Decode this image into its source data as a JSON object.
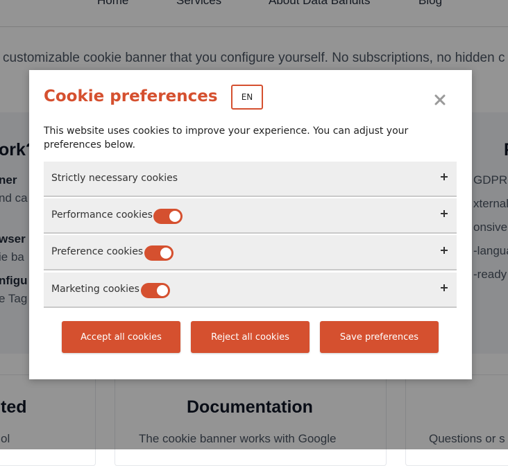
{
  "background": {
    "nav": [
      "Home",
      "Services",
      "About Data Bandits",
      "Blog"
    ],
    "intro": "customizable cookie banner that you configure yourself. No subscriptions, no hidden c",
    "left_col": {
      "heading": "ork?",
      "items": [
        {
          "title": "ner",
          "sub": "nd ca"
        },
        {
          "title": "wser",
          "sub": "ie ba"
        },
        {
          "title": "nfigu",
          "sub": "e Tag"
        }
      ]
    },
    "right_col": {
      "heading": "F",
      "lines": [
        "GDPR-",
        "xternal",
        "onsive",
        "-langua",
        "-ready"
      ]
    },
    "cards": [
      {
        "title": "ted",
        "text": "ol"
      },
      {
        "title": "Documentation",
        "text": "The cookie banner works with Google"
      },
      {
        "title": "",
        "text": "Questions or s"
      }
    ]
  },
  "modal": {
    "title": "Cookie preferences",
    "language": "EN",
    "description": "This website uses cookies to improve your experience. You can adjust your preferences below.",
    "categories": [
      {
        "label": "Strictly necessary cookies",
        "has_toggle": false
      },
      {
        "label": "Performance cookies",
        "has_toggle": true,
        "enabled": true
      },
      {
        "label": "Preference cookies",
        "has_toggle": true,
        "enabled": true
      },
      {
        "label": "Marketing cookies",
        "has_toggle": true,
        "enabled": true
      }
    ],
    "buttons": {
      "accept": "Accept all cookies",
      "reject": "Reject all cookies",
      "save": "Save preferences"
    }
  },
  "colors": {
    "accent": "#d5502f",
    "category_bg": "#eeeeee",
    "overlay": "rgba(0,0,0,0.42)"
  }
}
